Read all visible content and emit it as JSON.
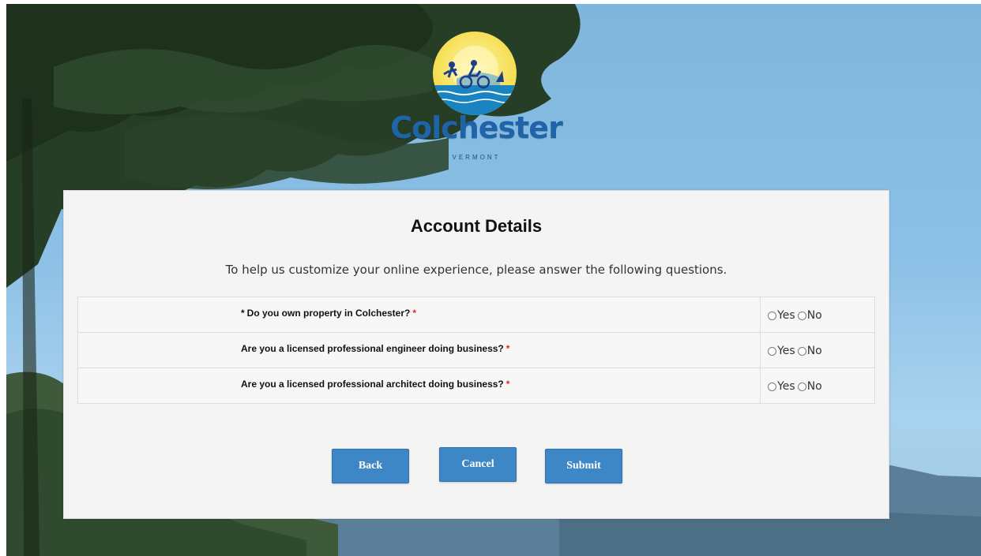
{
  "branding": {
    "logo_wordmark": "Colchester",
    "logo_subtitle": "VERMONT"
  },
  "form": {
    "title": "Account Details",
    "intro": "To help us customize your online experience, please answer the following questions.",
    "required_marker": "*",
    "questions": [
      {
        "prefix": "*",
        "text": "Do you own property in Colchester?",
        "options": [
          "Yes",
          "No"
        ]
      },
      {
        "prefix": "",
        "text": "Are you a licensed professional engineer doing business?",
        "options": [
          "Yes",
          "No"
        ]
      },
      {
        "prefix": "",
        "text": "Are you a licensed professional architect doing business?",
        "options": [
          "Yes",
          "No"
        ]
      }
    ]
  },
  "buttons": {
    "back": "Back",
    "cancel": "Cancel",
    "submit": "Submit"
  },
  "colors": {
    "button": "#3e87c6",
    "required": "#d62a2a",
    "brand_blue": "#1f63a8",
    "logo_sun": "#f6df58"
  }
}
